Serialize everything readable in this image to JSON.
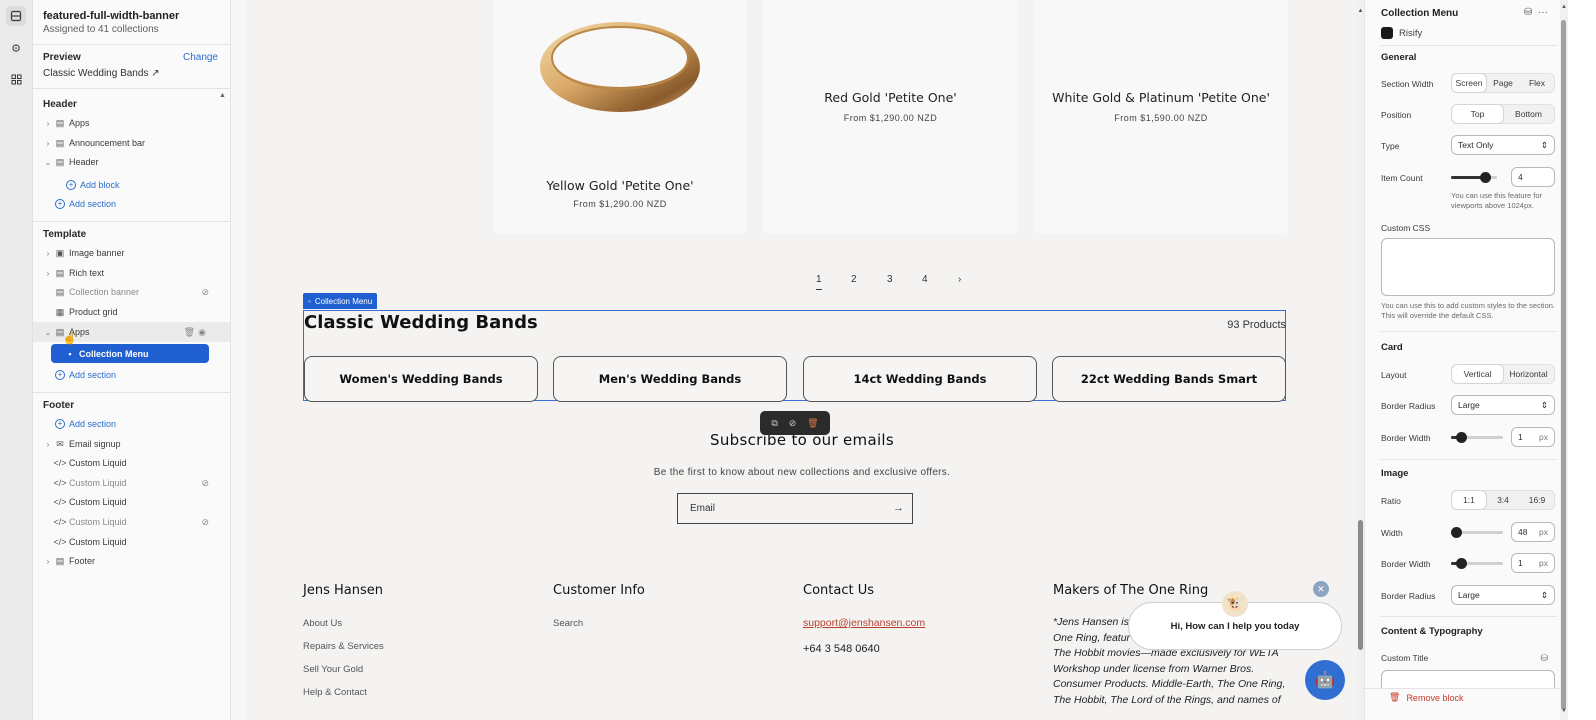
{
  "rail": {
    "items": [
      {
        "icon": "sections-icon"
      },
      {
        "icon": "gear-icon"
      },
      {
        "icon": "apps-icon"
      }
    ]
  },
  "left": {
    "title": "featured-full-width-banner",
    "subtitle": "Assigned to 41 collections",
    "preview_label": "Preview",
    "preview_change": "Change",
    "preview_value": "Classic Wedding Bands",
    "header_group": "Header",
    "header_items": [
      "Apps",
      "Announcement bar",
      "Header"
    ],
    "add_block": "Add block",
    "add_section": "Add section",
    "template_group": "Template",
    "template_items": [
      "Image banner",
      "Rich text",
      "Collection banner",
      "Product grid",
      "Apps"
    ],
    "selected_block": "Collection Menu",
    "footer_group": "Footer",
    "footer_items": [
      "Email signup",
      "Custom Liquid",
      "Custom Liquid",
      "Custom Liquid",
      "Custom Liquid",
      "Custom Liquid",
      "Footer"
    ]
  },
  "preview": {
    "products": [
      {
        "name": "Yellow Gold 'Petite One'",
        "price": "From $1,290.00 NZD"
      },
      {
        "name": "Red Gold 'Petite One'",
        "price": "From $1,290.00 NZD"
      },
      {
        "name": "White Gold & Platinum 'Petite One'",
        "price": "From $1,590.00 NZD"
      }
    ],
    "pager": [
      "1",
      "2",
      "3",
      "4",
      "›"
    ],
    "collection_menu": {
      "tag": "Collection Menu",
      "title": "Classic Wedding Bands",
      "count": "93 Products",
      "buttons": [
        "Women's Wedding Bands",
        "Men's Wedding Bands",
        "14ct Wedding Bands",
        "22ct Wedding Bands Smart"
      ]
    },
    "subscribe": {
      "title": "Subscribe to our emails",
      "text": "Be the first to know about new collections and exclusive offers.",
      "email_placeholder": "Email"
    },
    "footer": {
      "col1": {
        "heading": "Jens Hansen",
        "links": [
          "About Us",
          "Repairs & Services",
          "Sell Your Gold",
          "Help & Contact"
        ]
      },
      "col2": {
        "heading": "Customer Info",
        "links": [
          "Search"
        ]
      },
      "col3": {
        "heading": "Contact Us",
        "email": "support@jenshansen.com",
        "phone": "+64 3 548 0640"
      },
      "col4": {
        "heading": "Makers of The One Ring",
        "body": [
          "*Jens Hansen is",
          "One Ring, featur",
          "The Hobbit movies—made exclusively for WETA",
          "Workshop under license from Warner Bros.",
          "Consumer Products. Middle-Earth, The One Ring,",
          "The Hobbit, The Lord of the Rings, and names of"
        ]
      }
    },
    "chat": {
      "message": "Hi, How can I help you today"
    }
  },
  "right": {
    "title": "Collection Menu",
    "app": "Risify",
    "general": "General",
    "section_width": {
      "label": "Section Width",
      "options": [
        "Screen",
        "Page",
        "Flex"
      ],
      "selected": "Screen"
    },
    "position": {
      "label": "Position",
      "options": [
        "Top",
        "Bottom"
      ],
      "selected": "Top"
    },
    "type": {
      "label": "Type",
      "value": "Text Only"
    },
    "item_count": {
      "label": "Item Count",
      "value": "4",
      "help": "You can use this feature for viewports above 1024px."
    },
    "custom_css": {
      "label": "Custom CSS",
      "help": "You can use this to add custom styles to the section. This will override the default CSS."
    },
    "card": "Card",
    "layout": {
      "label": "Layout",
      "options": [
        "Vertical",
        "Horizontal"
      ],
      "selected": "Vertical"
    },
    "border_radius": {
      "label": "Border Radius",
      "value": "Large"
    },
    "border_width": {
      "label": "Border Width",
      "value": "1",
      "unit": "px"
    },
    "image": "Image",
    "ratio": {
      "label": "Ratio",
      "options": [
        "1:1",
        "3:4",
        "16:9"
      ],
      "selected": "1:1"
    },
    "width": {
      "label": "Width",
      "value": "48",
      "unit": "px"
    },
    "img_border_width": {
      "label": "Border Width",
      "value": "1",
      "unit": "px"
    },
    "img_border_radius": {
      "label": "Border Radius",
      "value": "Large"
    },
    "content_typography": "Content & Typography",
    "custom_title": "Custom Title",
    "remove_block": "Remove block"
  }
}
